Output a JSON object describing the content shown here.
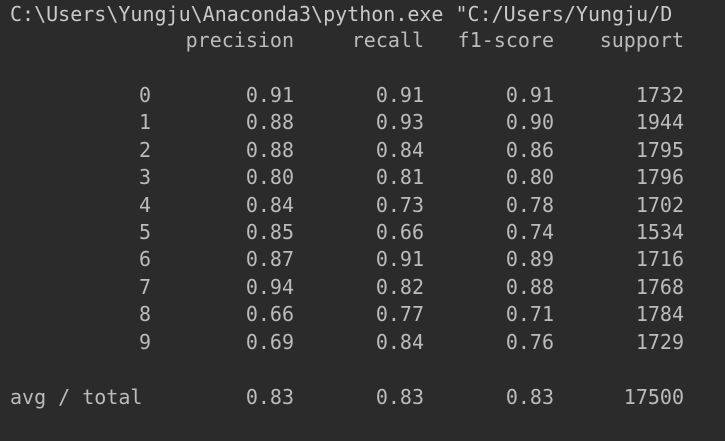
{
  "console": {
    "command": "C:\\Users\\Yungju\\Anaconda3\\python.exe \"C:/Users/Yungju/D",
    "headers": [
      "precision",
      "recall",
      "f1-score",
      "support"
    ],
    "rows": [
      {
        "label": "0",
        "precision": "0.91",
        "recall": "0.91",
        "f1": "0.91",
        "support": "1732"
      },
      {
        "label": "1",
        "precision": "0.88",
        "recall": "0.93",
        "f1": "0.90",
        "support": "1944"
      },
      {
        "label": "2",
        "precision": "0.88",
        "recall": "0.84",
        "f1": "0.86",
        "support": "1795"
      },
      {
        "label": "3",
        "precision": "0.80",
        "recall": "0.81",
        "f1": "0.80",
        "support": "1796"
      },
      {
        "label": "4",
        "precision": "0.84",
        "recall": "0.73",
        "f1": "0.78",
        "support": "1702"
      },
      {
        "label": "5",
        "precision": "0.85",
        "recall": "0.66",
        "f1": "0.74",
        "support": "1534"
      },
      {
        "label": "6",
        "precision": "0.87",
        "recall": "0.91",
        "f1": "0.89",
        "support": "1716"
      },
      {
        "label": "7",
        "precision": "0.94",
        "recall": "0.82",
        "f1": "0.88",
        "support": "1768"
      },
      {
        "label": "8",
        "precision": "0.66",
        "recall": "0.77",
        "f1": "0.71",
        "support": "1784"
      },
      {
        "label": "9",
        "precision": "0.69",
        "recall": "0.84",
        "f1": "0.76",
        "support": "1729"
      }
    ],
    "total": {
      "label": "avg / total",
      "precision": "0.83",
      "recall": "0.83",
      "f1": "0.83",
      "support": "17500"
    },
    "colors": {
      "background": "#2b2b2b",
      "text": "#bbbbbb"
    }
  }
}
